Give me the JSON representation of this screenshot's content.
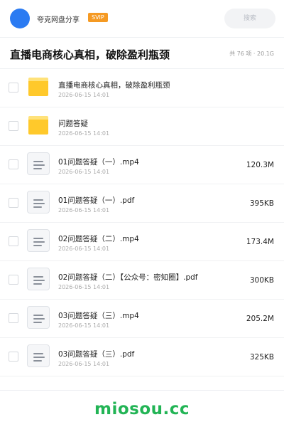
{
  "header": {
    "app_name": "夸克网盘分享",
    "badge": "SVIP",
    "search_label": "搜索",
    "accent_color": "#2b7bf2"
  },
  "title_bar": {
    "title": "直播电商核心真相，破除盈利瓶颈",
    "meta": "共 76 项 · 20.1G"
  },
  "files": [
    {
      "type": "folder",
      "icon": "folder-icon",
      "name": "直播电商核心真相，破除盈利瓶颈",
      "date": "2026-06-15 14:01",
      "size": ""
    },
    {
      "type": "folder",
      "icon": "folder-icon",
      "name": "问题答疑",
      "date": "2026-06-15 14:01",
      "size": ""
    },
    {
      "type": "file",
      "icon": "document-icon",
      "name": "01问题答疑（一）.mp4",
      "date": "2026-06-15 14:01",
      "size": "120.3M"
    },
    {
      "type": "file",
      "icon": "document-icon",
      "name": "01问题答疑（一）.pdf",
      "date": "2026-06-15 14:01",
      "size": "395KB"
    },
    {
      "type": "file",
      "icon": "document-icon",
      "name": "02问题答疑（二）.mp4",
      "date": "2026-06-15 14:01",
      "size": "173.4M"
    },
    {
      "type": "file",
      "icon": "document-icon",
      "name": "02问题答疑（二）【公众号：密知圈】.pdf",
      "date": "2026-06-15 14:01",
      "size": "300KB"
    },
    {
      "type": "file",
      "icon": "document-icon",
      "name": "03问题答疑（三）.mp4",
      "date": "2026-06-15 14:01",
      "size": "205.2M"
    },
    {
      "type": "file",
      "icon": "document-icon",
      "name": "03问题答疑（三）.pdf",
      "date": "2026-06-15 14:01",
      "size": "325KB"
    }
  ],
  "watermark": {
    "text": "miosou.cc",
    "color": "#22b455"
  }
}
